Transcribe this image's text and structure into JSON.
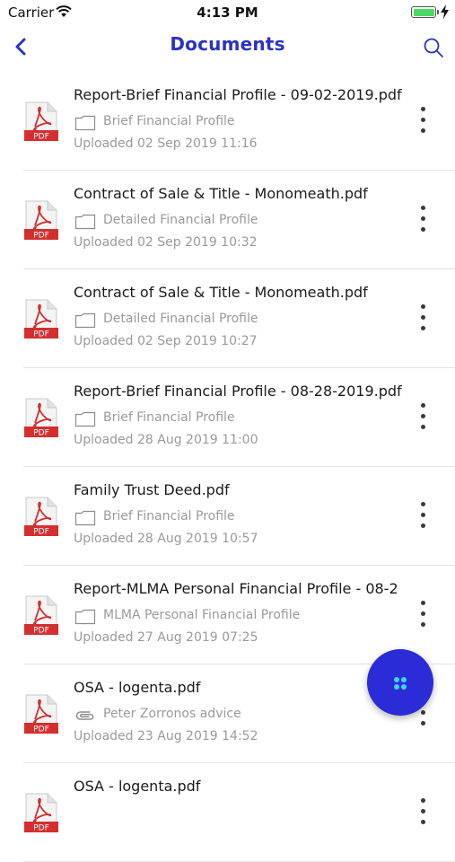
{
  "status_bar": {
    "carrier": "Carrier",
    "time": "4:13 PM"
  },
  "nav": {
    "title": "Documents"
  },
  "colors": {
    "accent": "#2b32c4",
    "fab": "#2b2bd8",
    "pdf_red": "#d32f2f",
    "muted_text": "#9a9a9a"
  },
  "icons": {
    "back": "chevron-left-icon",
    "search": "search-icon",
    "file": "pdf-file-icon",
    "folder": "folder-icon",
    "attachment": "paperclip-icon",
    "more": "more-vertical-icon",
    "fab": "dots-grid-icon"
  },
  "documents": [
    {
      "title": "Report-Brief Financial Profile - 09-02-2019.pdf",
      "folder": "Brief Financial Profile",
      "folder_icon": "folder",
      "uploaded": "Uploaded 02 Sep 2019 11:16",
      "file_badge": "PDF"
    },
    {
      "title": "Contract of Sale & Title - Monomeath.pdf",
      "folder": "Detailed Financial Profile",
      "folder_icon": "folder",
      "uploaded": "Uploaded 02 Sep 2019 10:32",
      "file_badge": "PDF"
    },
    {
      "title": "Contract of Sale & Title - Monomeath.pdf",
      "folder": "Detailed Financial Profile",
      "folder_icon": "folder",
      "uploaded": "Uploaded 02 Sep 2019 10:27",
      "file_badge": "PDF"
    },
    {
      "title": "Report-Brief Financial Profile - 08-28-2019.pdf",
      "folder": "Brief Financial Profile",
      "folder_icon": "folder",
      "uploaded": "Uploaded 28 Aug 2019 11:00",
      "file_badge": "PDF"
    },
    {
      "title": "Family Trust Deed.pdf",
      "folder": "Brief Financial Profile",
      "folder_icon": "folder",
      "uploaded": "Uploaded 28 Aug 2019 10:57",
      "file_badge": "PDF"
    },
    {
      "title": "Report-MLMA Personal Financial Profile - 08-2",
      "folder": "MLMA Personal Financial Profile",
      "folder_icon": "folder",
      "uploaded": "Uploaded 27 Aug 2019 07:25",
      "file_badge": "PDF"
    },
    {
      "title": "OSA - logenta.pdf",
      "folder": "Peter Zorronos advice",
      "folder_icon": "attachment",
      "uploaded": "Uploaded 23 Aug 2019 14:52",
      "file_badge": "PDF"
    },
    {
      "title": "OSA - logenta.pdf",
      "folder": "",
      "folder_icon": "none",
      "uploaded": "",
      "file_badge": "PDF"
    }
  ]
}
